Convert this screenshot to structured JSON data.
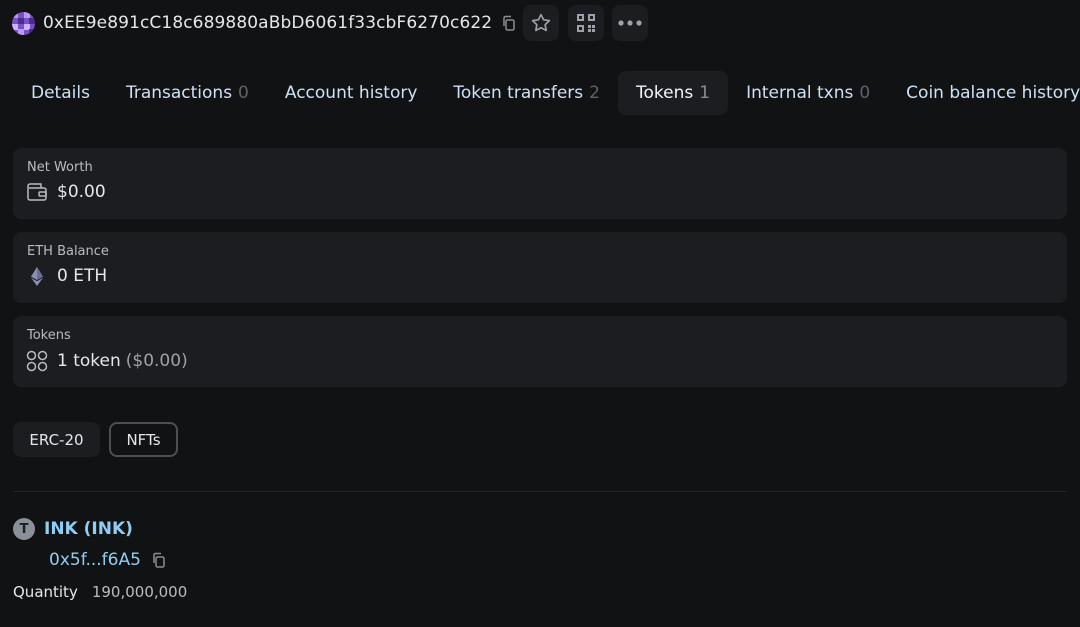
{
  "header": {
    "address": "0xEE9e891cC18c689880aBbD6061f33cbF6270c622",
    "icons": [
      "copy-icon",
      "star-icon",
      "qr-code-icon",
      "more-icon"
    ]
  },
  "tabs": [
    {
      "label": "Details",
      "count": ""
    },
    {
      "label": "Transactions",
      "count": "0"
    },
    {
      "label": "Account history",
      "count": ""
    },
    {
      "label": "Token transfers",
      "count": "2"
    },
    {
      "label": "Tokens",
      "count": "1",
      "active": true
    },
    {
      "label": "Internal txns",
      "count": "0"
    },
    {
      "label": "Coin balance history",
      "count": ""
    }
  ],
  "net_worth": {
    "label": "Net Worth",
    "value": "$0.00",
    "icon": "wallet-icon"
  },
  "eth_balance": {
    "label": "ETH Balance",
    "value": "0 ETH",
    "icon": "ethereum-icon"
  },
  "tokens_summary": {
    "label": "Tokens",
    "value": "1 token",
    "value_usd": "($0.00)",
    "icon": "tokens-icon"
  },
  "filters": {
    "erc20": "ERC-20",
    "nfts": "NFTs"
  },
  "token": {
    "badge": "T",
    "name": "INK (INK)",
    "address": "0x5f...f6A5",
    "quantity_label": "Quantity",
    "quantity_value": "190,000,000"
  },
  "colors": {
    "background": "#111214",
    "card": "#1c1d21",
    "link": "#90cdf4",
    "tab_text": "#cfe1f6"
  }
}
